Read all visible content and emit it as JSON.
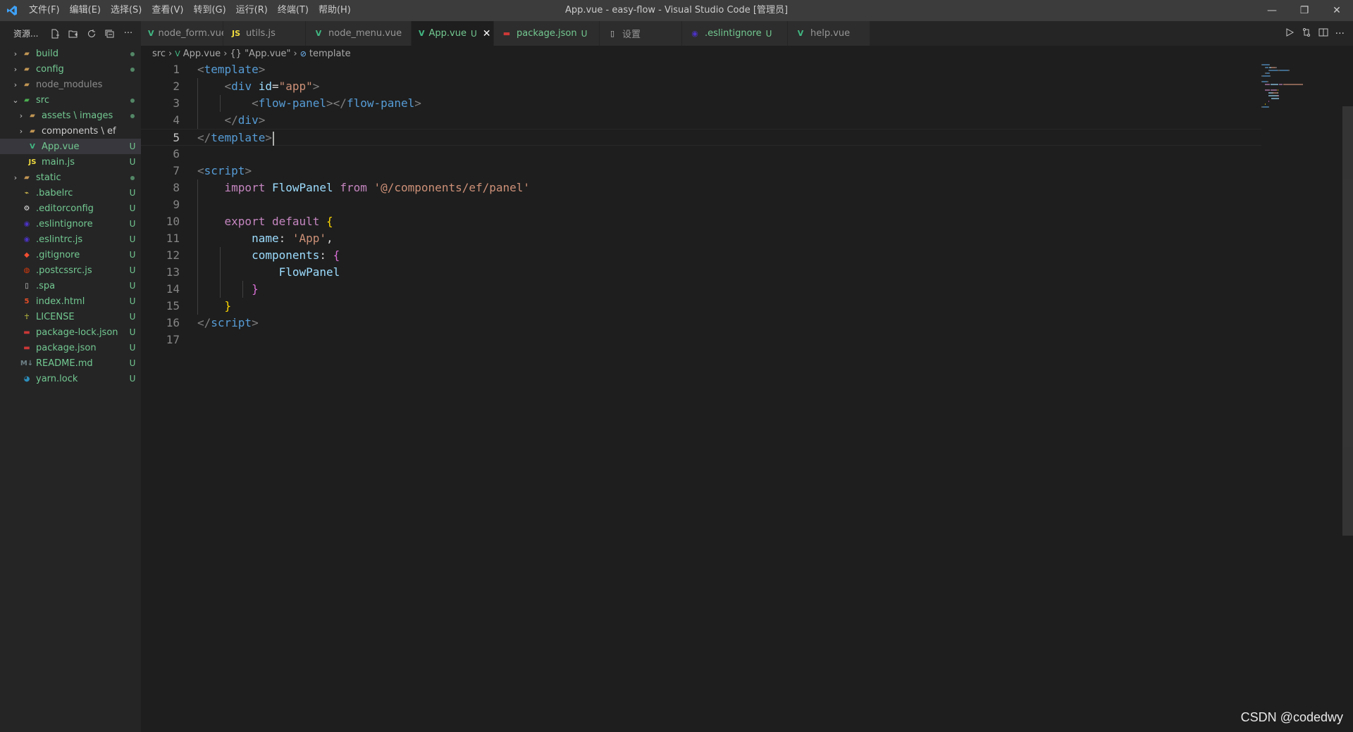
{
  "window": {
    "title": "App.vue - easy-flow - Visual Studio Code [管理员]",
    "menu": [
      "文件(F)",
      "编辑(E)",
      "选择(S)",
      "查看(V)",
      "转到(G)",
      "运行(R)",
      "终端(T)",
      "帮助(H)"
    ],
    "controls": {
      "minimize": "—",
      "restore": "❐",
      "close": "✕"
    }
  },
  "sidebar": {
    "title": "资源...",
    "actions": [
      "new-file-icon",
      "new-folder-icon",
      "refresh-icon",
      "collapse-icon",
      "more-icon"
    ],
    "more_label": "···",
    "items": [
      {
        "label": "build",
        "depth": 0,
        "chevron": "›",
        "icon": "folder-icon",
        "status": "dot",
        "color": "#73c991"
      },
      {
        "label": "config",
        "depth": 0,
        "chevron": "›",
        "icon": "folder-icon",
        "status": "dot",
        "color": "#73c991"
      },
      {
        "label": "node_modules",
        "depth": 0,
        "chevron": "›",
        "icon": "folder-icon",
        "status": "",
        "color": "#8c8c8c"
      },
      {
        "label": "src",
        "depth": 0,
        "chevron": "⌄",
        "icon": "folder-open-icon",
        "status": "dot",
        "color": "#73c991"
      },
      {
        "label": "assets \\ images",
        "depth": 1,
        "chevron": "›",
        "icon": "folder-icon",
        "status": "dot",
        "color": "#73c991"
      },
      {
        "label": "components \\ ef",
        "depth": 1,
        "chevron": "›",
        "icon": "folder-icon",
        "status": "",
        "color": "#cccccc"
      },
      {
        "label": "App.vue",
        "depth": 1,
        "chevron": "",
        "icon": "vue-icon",
        "status": "U",
        "color": "#73c991",
        "selected": true
      },
      {
        "label": "main.js",
        "depth": 1,
        "chevron": "",
        "icon": "js-icon",
        "status": "U",
        "color": "#73c991"
      },
      {
        "label": "static",
        "depth": 0,
        "chevron": "›",
        "icon": "folder-icon",
        "status": "dot",
        "color": "#73c991"
      },
      {
        "label": ".babelrc",
        "depth": 0,
        "chevron": "",
        "icon": "babel-icon",
        "status": "U",
        "color": "#73c991"
      },
      {
        "label": ".editorconfig",
        "depth": 0,
        "chevron": "",
        "icon": "editorconfig-icon",
        "status": "U",
        "color": "#73c991"
      },
      {
        "label": ".eslintignore",
        "depth": 0,
        "chevron": "",
        "icon": "eslint-icon",
        "status": "U",
        "color": "#73c991"
      },
      {
        "label": ".eslintrc.js",
        "depth": 0,
        "chevron": "",
        "icon": "eslint-icon",
        "status": "U",
        "color": "#73c991"
      },
      {
        "label": ".gitignore",
        "depth": 0,
        "chevron": "",
        "icon": "git-icon",
        "status": "U",
        "color": "#73c991"
      },
      {
        "label": ".postcssrc.js",
        "depth": 0,
        "chevron": "",
        "icon": "postcss-icon",
        "status": "U",
        "color": "#73c991"
      },
      {
        "label": ".spa",
        "depth": 0,
        "chevron": "",
        "icon": "file-icon",
        "status": "U",
        "color": "#73c991"
      },
      {
        "label": "index.html",
        "depth": 0,
        "chevron": "",
        "icon": "html-icon",
        "status": "U",
        "color": "#73c991"
      },
      {
        "label": "LICENSE",
        "depth": 0,
        "chevron": "",
        "icon": "license-icon",
        "status": "U",
        "color": "#73c991"
      },
      {
        "label": "package-lock.json",
        "depth": 0,
        "chevron": "",
        "icon": "npm-icon",
        "status": "U",
        "color": "#73c991"
      },
      {
        "label": "package.json",
        "depth": 0,
        "chevron": "",
        "icon": "npm-icon",
        "status": "U",
        "color": "#73c991"
      },
      {
        "label": "README.md",
        "depth": 0,
        "chevron": "",
        "icon": "markdown-icon",
        "status": "U",
        "color": "#73c991"
      },
      {
        "label": "yarn.lock",
        "depth": 0,
        "chevron": "",
        "icon": "yarn-icon",
        "status": "U",
        "color": "#73c991"
      }
    ]
  },
  "tabs": [
    {
      "label": "node_form.vue",
      "icon": "vue-icon",
      "status": "",
      "active": false,
      "width": 117
    },
    {
      "label": "utils.js",
      "icon": "js-icon",
      "status": "",
      "active": false,
      "width": 117
    },
    {
      "label": "node_menu.vue",
      "icon": "vue-icon",
      "status": "",
      "active": false,
      "width": 150
    },
    {
      "label": "App.vue",
      "icon": "vue-icon",
      "status": "U",
      "active": true,
      "close": "✕",
      "width": 117
    },
    {
      "label": "package.json",
      "icon": "npm-icon",
      "status": "U",
      "active": false,
      "width": 150
    },
    {
      "label": "设置",
      "icon": "file-icon",
      "status": "",
      "active": false,
      "width": 117
    },
    {
      "label": ".eslintignore",
      "icon": "eslint-icon",
      "status": "U",
      "active": false,
      "width": 150
    },
    {
      "label": "help.vue",
      "icon": "vue-icon",
      "status": "",
      "active": false,
      "width": 117
    }
  ],
  "tab_actions": [
    "run-icon",
    "compare-icon",
    "split-editor-icon",
    "more-icon"
  ],
  "breadcrumb": {
    "parts": [
      "src",
      "App.vue",
      "{} \"App.vue\"",
      "template"
    ]
  },
  "editor": {
    "active_line": 5,
    "lines": [
      [
        {
          "t": "<",
          "c": "tk-punc"
        },
        {
          "t": "template",
          "c": "tk-tag"
        },
        {
          "t": ">",
          "c": "tk-punc"
        }
      ],
      [
        {
          "t": "    ",
          "c": "tk-plain"
        },
        {
          "t": "<",
          "c": "tk-punc"
        },
        {
          "t": "div",
          "c": "tk-tag"
        },
        {
          "t": " ",
          "c": "tk-plain"
        },
        {
          "t": "id",
          "c": "tk-attr"
        },
        {
          "t": "=",
          "c": "tk-plain"
        },
        {
          "t": "\"app\"",
          "c": "tk-str"
        },
        {
          "t": ">",
          "c": "tk-punc"
        }
      ],
      [
        {
          "t": "        ",
          "c": "tk-plain"
        },
        {
          "t": "<",
          "c": "tk-punc"
        },
        {
          "t": "flow-panel",
          "c": "tk-tag"
        },
        {
          "t": "></",
          "c": "tk-punc"
        },
        {
          "t": "flow-panel",
          "c": "tk-tag"
        },
        {
          "t": ">",
          "c": "tk-punc"
        }
      ],
      [
        {
          "t": "    ",
          "c": "tk-plain"
        },
        {
          "t": "</",
          "c": "tk-punc"
        },
        {
          "t": "div",
          "c": "tk-tag"
        },
        {
          "t": ">",
          "c": "tk-punc"
        }
      ],
      [
        {
          "t": "</",
          "c": "tk-punc"
        },
        {
          "t": "template",
          "c": "tk-tag"
        },
        {
          "t": ">",
          "c": "tk-punc"
        }
      ],
      [],
      [
        {
          "t": "<",
          "c": "tk-punc"
        },
        {
          "t": "script",
          "c": "tk-tag"
        },
        {
          "t": ">",
          "c": "tk-punc"
        }
      ],
      [
        {
          "t": "    ",
          "c": "tk-plain"
        },
        {
          "t": "import",
          "c": "tk-kw"
        },
        {
          "t": " ",
          "c": "tk-plain"
        },
        {
          "t": "FlowPanel",
          "c": "tk-var"
        },
        {
          "t": " ",
          "c": "tk-plain"
        },
        {
          "t": "from",
          "c": "tk-kw"
        },
        {
          "t": " ",
          "c": "tk-plain"
        },
        {
          "t": "'@/components/ef/panel'",
          "c": "tk-str"
        }
      ],
      [],
      [
        {
          "t": "    ",
          "c": "tk-plain"
        },
        {
          "t": "export",
          "c": "tk-kw"
        },
        {
          "t": " ",
          "c": "tk-plain"
        },
        {
          "t": "default",
          "c": "tk-kw"
        },
        {
          "t": " ",
          "c": "tk-plain"
        },
        {
          "t": "{",
          "c": "tk-brace"
        }
      ],
      [
        {
          "t": "        ",
          "c": "tk-plain"
        },
        {
          "t": "name",
          "c": "tk-prop"
        },
        {
          "t": ": ",
          "c": "tk-plain"
        },
        {
          "t": "'App'",
          "c": "tk-str"
        },
        {
          "t": ",",
          "c": "tk-plain"
        }
      ],
      [
        {
          "t": "        ",
          "c": "tk-plain"
        },
        {
          "t": "components",
          "c": "tk-prop"
        },
        {
          "t": ": ",
          "c": "tk-plain"
        },
        {
          "t": "{",
          "c": "tk-brace2"
        }
      ],
      [
        {
          "t": "            ",
          "c": "tk-plain"
        },
        {
          "t": "FlowPanel",
          "c": "tk-var"
        }
      ],
      [
        {
          "t": "        ",
          "c": "tk-plain"
        },
        {
          "t": "}",
          "c": "tk-brace2"
        }
      ],
      [
        {
          "t": "    ",
          "c": "tk-plain"
        },
        {
          "t": "}",
          "c": "tk-brace"
        }
      ],
      [
        {
          "t": "</",
          "c": "tk-punc"
        },
        {
          "t": "script",
          "c": "tk-tag"
        },
        {
          "t": ">",
          "c": "tk-punc"
        }
      ],
      []
    ]
  },
  "watermark": "CSDN @codedwy"
}
